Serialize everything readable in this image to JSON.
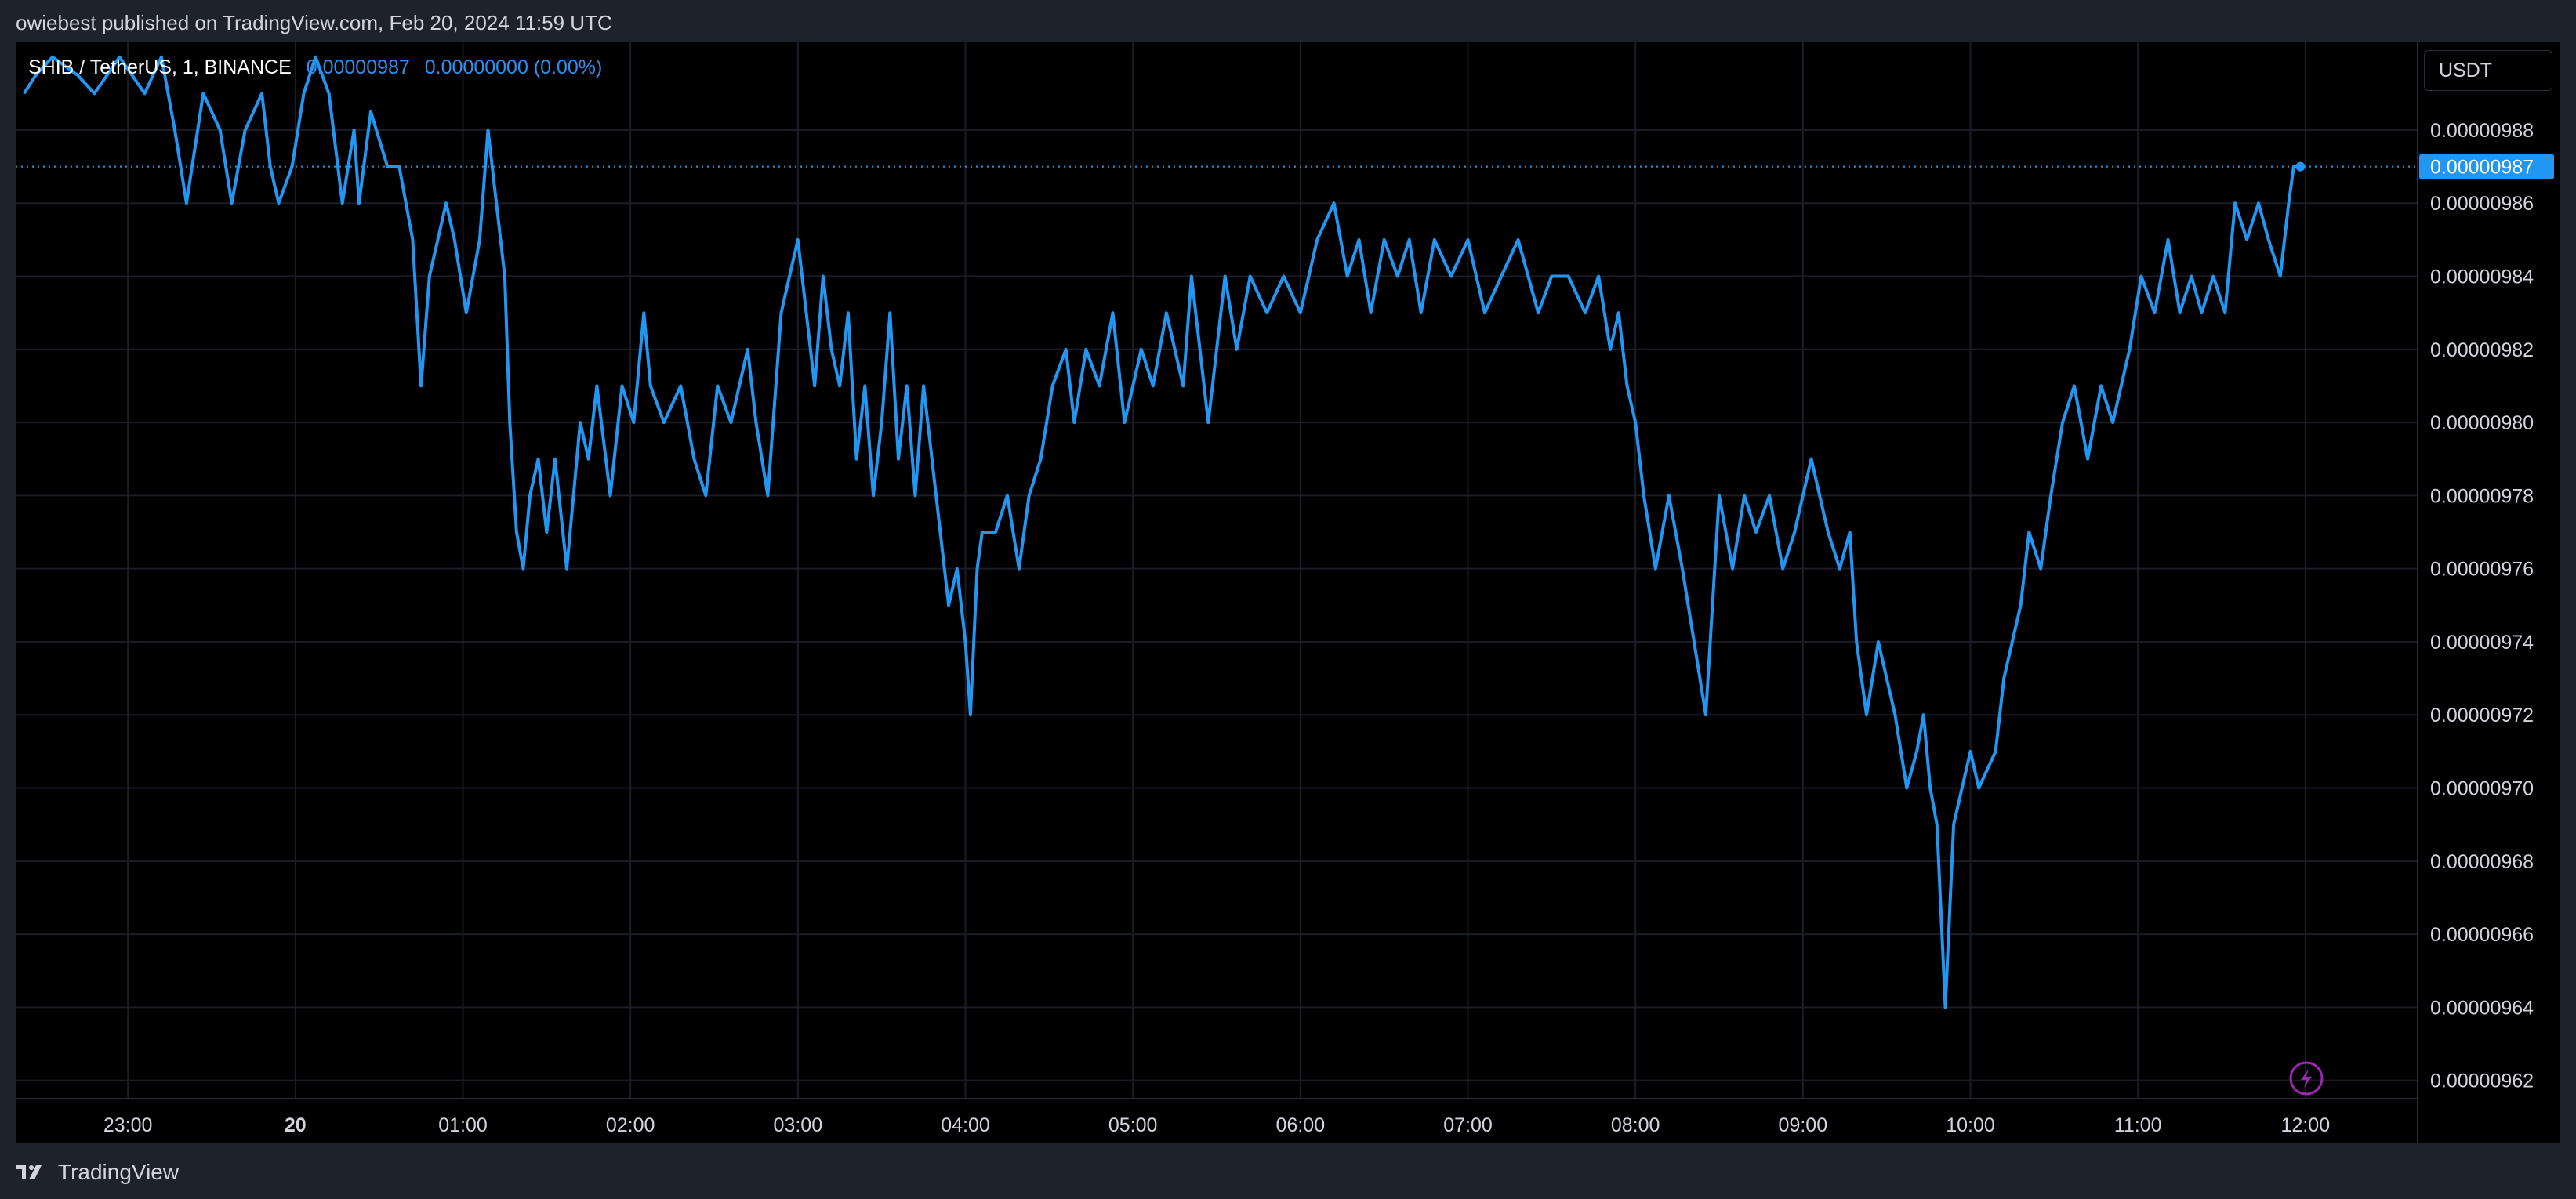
{
  "header": {
    "published_text": "owiebest published on TradingView.com, Feb 20, 2024 11:59 UTC"
  },
  "legend": {
    "symbol": "SHIB / TetherUS, 1, BINANCE",
    "last_value": "0.00000987",
    "change": "0.00000000 (0.00%)"
  },
  "price_axis": {
    "currency": "USDT",
    "last_price_label": "0.00000987"
  },
  "footer": {
    "brand": "TradingView"
  },
  "colors": {
    "line": "#2196f3",
    "background": "#000000",
    "panel": "#1e222d",
    "grid": "#1a1d26",
    "last_label_bg": "#2196f3",
    "lightning_badge": "#9c27b0"
  },
  "icons": {
    "footer_logo": "tradingview-logo-icon",
    "badge": "lightning-icon"
  },
  "chart_data": {
    "type": "line",
    "title": "SHIB / TetherUS, 1, BINANCE",
    "ylabel": "USDT",
    "grid": true,
    "ylim": [
      9.615e-06,
      9.904e-06
    ],
    "y_ticks": [
      "0.00000988",
      "0.00000986",
      "0.00000984",
      "0.00000982",
      "0.00000980",
      "0.00000978",
      "0.00000976",
      "0.00000974",
      "0.00000972",
      "0.00000970",
      "0.00000968",
      "0.00000966",
      "0.00000964",
      "0.00000962"
    ],
    "y_tick_values": [
      9.88e-06,
      9.86e-06,
      9.84e-06,
      9.82e-06,
      9.8e-06,
      9.78e-06,
      9.76e-06,
      9.74e-06,
      9.72e-06,
      9.7e-06,
      9.68e-06,
      9.66e-06,
      9.64e-06,
      9.62e-06
    ],
    "x_ticks": [
      "23:00",
      "20",
      "01:00",
      "02:00",
      "03:00",
      "04:00",
      "05:00",
      "06:00",
      "07:00",
      "08:00",
      "09:00",
      "10:00",
      "11:00",
      "12:00"
    ],
    "x_tick_hours": [
      -1,
      0,
      1,
      2,
      3,
      4,
      5,
      6,
      7,
      8,
      9,
      10,
      11,
      12
    ],
    "xlim_hours": [
      -1.67,
      12.67
    ],
    "series": [
      {
        "x_hours": [
          -1.62,
          -1.55,
          -1.45,
          -1.3,
          -1.2,
          -1.05,
          -0.9,
          -0.8,
          -0.72,
          -0.65,
          -0.55,
          -0.45,
          -0.38,
          -0.3,
          -0.2,
          -0.15,
          -0.1,
          -0.02,
          0.05,
          0.12,
          0.2,
          0.28,
          0.35,
          0.38,
          0.45,
          0.55,
          0.62,
          0.7,
          0.75,
          0.8,
          0.9,
          0.95,
          1.02,
          1.1,
          1.15,
          1.2,
          1.25,
          1.28,
          1.32,
          1.36,
          1.4,
          1.45,
          1.5,
          1.55,
          1.62,
          1.7,
          1.75,
          1.8,
          1.88,
          1.95,
          2.02,
          2.08,
          2.12,
          2.2,
          2.3,
          2.38,
          2.45,
          2.52,
          2.6,
          2.7,
          2.75,
          2.82,
          2.9,
          2.95,
          3.0,
          3.05,
          3.1,
          3.15,
          3.2,
          3.25,
          3.3,
          3.35,
          3.4,
          3.45,
          3.5,
          3.55,
          3.6,
          3.65,
          3.7,
          3.75,
          3.8,
          3.85,
          3.9,
          3.95,
          4.0,
          4.03,
          4.07,
          4.1,
          4.18,
          4.25,
          4.32,
          4.38,
          4.45,
          4.52,
          4.6,
          4.65,
          4.72,
          4.8,
          4.88,
          4.95,
          5.05,
          5.12,
          5.2,
          5.3,
          5.35,
          5.45,
          5.55,
          5.62,
          5.7,
          5.8,
          5.9,
          6.0,
          6.1,
          6.2,
          6.28,
          6.35,
          6.42,
          6.5,
          6.58,
          6.65,
          6.72,
          6.8,
          6.9,
          7.0,
          7.1,
          7.2,
          7.3,
          7.42,
          7.5,
          7.6,
          7.7,
          7.78,
          7.85,
          7.9,
          7.95,
          8.0,
          8.05,
          8.12,
          8.2,
          8.28,
          8.35,
          8.42,
          8.5,
          8.58,
          8.65,
          8.72,
          8.8,
          8.88,
          8.95,
          9.0,
          9.05,
          9.1,
          9.15,
          9.22,
          9.28,
          9.32,
          9.38,
          9.45,
          9.55,
          9.62,
          9.68,
          9.72,
          9.76,
          9.8,
          9.85,
          9.9,
          9.95,
          10.0,
          10.05,
          10.15,
          10.2,
          10.25,
          10.3,
          10.35,
          10.42,
          10.48,
          10.55,
          10.62,
          10.7,
          10.78,
          10.85,
          10.9,
          10.95,
          11.02,
          11.1,
          11.18,
          11.25,
          11.32,
          11.38,
          11.45,
          11.52,
          11.58,
          11.65,
          11.72,
          11.78,
          11.85,
          11.9,
          11.93,
          11.97
        ],
        "values": [
          9.89e-06,
          9.895e-06,
          9.9e-06,
          9.895e-06,
          9.89e-06,
          9.9e-06,
          9.89e-06,
          9.9e-06,
          9.88e-06,
          9.86e-06,
          9.89e-06,
          9.88e-06,
          9.86e-06,
          9.88e-06,
          9.89e-06,
          9.87e-06,
          9.86e-06,
          9.87e-06,
          9.89e-06,
          9.9e-06,
          9.89e-06,
          9.86e-06,
          9.88e-06,
          9.86e-06,
          9.885e-06,
          9.87e-06,
          9.87e-06,
          9.85e-06,
          9.81e-06,
          9.84e-06,
          9.86e-06,
          9.85e-06,
          9.83e-06,
          9.85e-06,
          9.88e-06,
          9.86e-06,
          9.84e-06,
          9.8e-06,
          9.77e-06,
          9.76e-06,
          9.78e-06,
          9.79e-06,
          9.77e-06,
          9.79e-06,
          9.76e-06,
          9.8e-06,
          9.79e-06,
          9.81e-06,
          9.78e-06,
          9.81e-06,
          9.8e-06,
          9.83e-06,
          9.81e-06,
          9.8e-06,
          9.81e-06,
          9.79e-06,
          9.78e-06,
          9.81e-06,
          9.8e-06,
          9.82e-06,
          9.8e-06,
          9.78e-06,
          9.83e-06,
          9.84e-06,
          9.85e-06,
          9.83e-06,
          9.81e-06,
          9.84e-06,
          9.82e-06,
          9.81e-06,
          9.83e-06,
          9.79e-06,
          9.81e-06,
          9.78e-06,
          9.8e-06,
          9.83e-06,
          9.79e-06,
          9.81e-06,
          9.78e-06,
          9.81e-06,
          9.79e-06,
          9.77e-06,
          9.75e-06,
          9.76e-06,
          9.74e-06,
          9.72e-06,
          9.76e-06,
          9.77e-06,
          9.77e-06,
          9.78e-06,
          9.76e-06,
          9.78e-06,
          9.79e-06,
          9.81e-06,
          9.82e-06,
          9.8e-06,
          9.82e-06,
          9.81e-06,
          9.83e-06,
          9.8e-06,
          9.82e-06,
          9.81e-06,
          9.83e-06,
          9.81e-06,
          9.84e-06,
          9.8e-06,
          9.84e-06,
          9.82e-06,
          9.84e-06,
          9.83e-06,
          9.84e-06,
          9.83e-06,
          9.85e-06,
          9.86e-06,
          9.84e-06,
          9.85e-06,
          9.83e-06,
          9.85e-06,
          9.84e-06,
          9.85e-06,
          9.83e-06,
          9.85e-06,
          9.84e-06,
          9.85e-06,
          9.83e-06,
          9.84e-06,
          9.85e-06,
          9.83e-06,
          9.84e-06,
          9.84e-06,
          9.83e-06,
          9.84e-06,
          9.82e-06,
          9.83e-06,
          9.81e-06,
          9.8e-06,
          9.78e-06,
          9.76e-06,
          9.78e-06,
          9.76e-06,
          9.74e-06,
          9.72e-06,
          9.78e-06,
          9.76e-06,
          9.78e-06,
          9.77e-06,
          9.78e-06,
          9.76e-06,
          9.77e-06,
          9.78e-06,
          9.79e-06,
          9.78e-06,
          9.77e-06,
          9.76e-06,
          9.77e-06,
          9.74e-06,
          9.72e-06,
          9.74e-06,
          9.72e-06,
          9.7e-06,
          9.71e-06,
          9.72e-06,
          9.7e-06,
          9.69e-06,
          9.64e-06,
          9.69e-06,
          9.7e-06,
          9.71e-06,
          9.7e-06,
          9.71e-06,
          9.73e-06,
          9.74e-06,
          9.75e-06,
          9.77e-06,
          9.76e-06,
          9.78e-06,
          9.8e-06,
          9.81e-06,
          9.79e-06,
          9.81e-06,
          9.8e-06,
          9.81e-06,
          9.82e-06,
          9.84e-06,
          9.83e-06,
          9.85e-06,
          9.83e-06,
          9.84e-06,
          9.83e-06,
          9.84e-06,
          9.83e-06,
          9.86e-06,
          9.85e-06,
          9.86e-06,
          9.85e-06,
          9.84e-06,
          9.86e-06,
          9.87e-06,
          9.87e-06
        ]
      }
    ],
    "last_value": 9.87e-06
  }
}
